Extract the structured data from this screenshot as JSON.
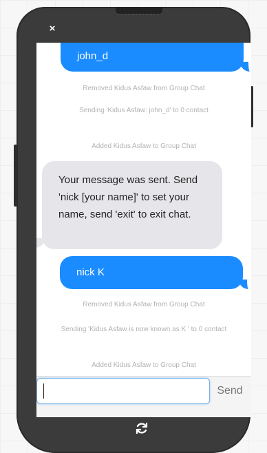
{
  "window": {
    "close_label": "×"
  },
  "messages": {
    "out_1": "john_d",
    "sys_1": "Removed Kidus Asfaw from Group Chat",
    "sys_2": "Sending 'Kidus Asfaw: john_d' to 0 contact",
    "sys_3": "Added Kidus Asfaw to Group Chat",
    "in_1": "Your message was sent. Send 'nick [your name]' to set your name, send 'exit' to exit chat.",
    "out_2": "nick K",
    "sys_4": "Removed Kidus Asfaw from Group Chat",
    "sys_5": "Sending 'Kidus Asfaw is now known as K ' to 0 contact",
    "sys_6": "Added Kidus Asfaw to Group Chat"
  },
  "composer": {
    "input_value": "",
    "input_placeholder": "",
    "send_label": "Send"
  },
  "footer": {
    "refresh_icon": "refresh-icon"
  },
  "colors": {
    "outgoing_bubble": "#1a8cff",
    "incoming_bubble": "#e6e6ea",
    "system_text": "#b2b2b2",
    "phone_body": "#3b3b3b"
  }
}
